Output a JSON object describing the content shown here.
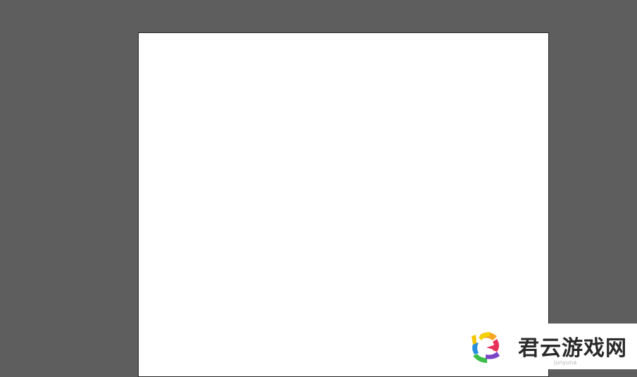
{
  "colors": {
    "workspace_background": "#5e5e5e",
    "artboard_background": "#ffffff",
    "artboard_border": "#1e1e1e",
    "watermark_text": "#2a2a2a"
  },
  "watermark": {
    "title": "君云游戏网",
    "subtitle": "junyuna",
    "logo_icon": "pinwheel-logo-icon"
  }
}
